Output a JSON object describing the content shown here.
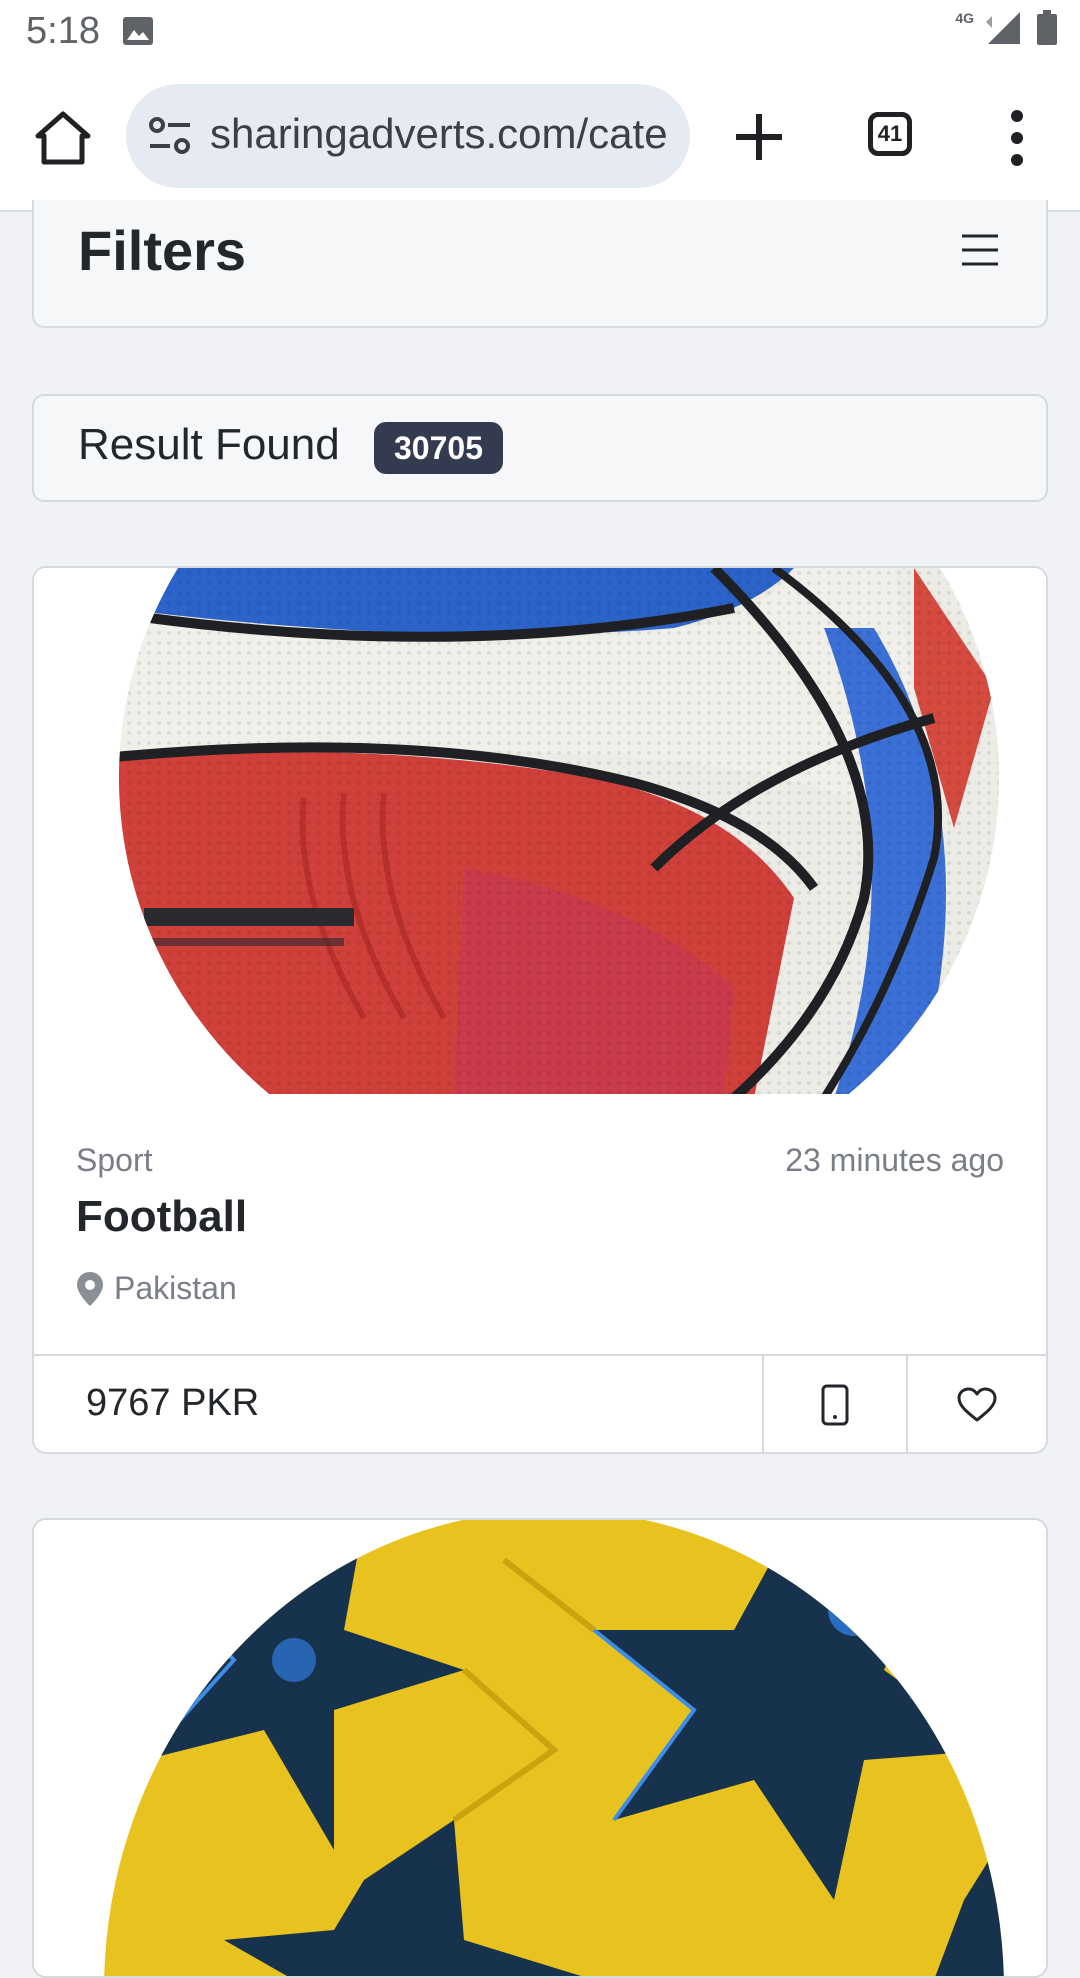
{
  "status_bar": {
    "time": "5:18",
    "network": "4G",
    "icons": [
      "image-icon",
      "signal-icon",
      "battery-icon"
    ]
  },
  "browser": {
    "url": "sharingadverts.com/cate",
    "tab_count": "41",
    "icons": [
      "home-icon",
      "site-settings-icon",
      "plus-icon",
      "more-vert-icon"
    ]
  },
  "filters": {
    "title": "Filters",
    "icon": "hamburger-icon"
  },
  "results": {
    "label": "Result Found",
    "count": "30705"
  },
  "ads": [
    {
      "category": "Sport",
      "time_ago": "23 minutes ago",
      "title": "Football",
      "location": "Pakistan",
      "price": "9767 PKR",
      "image": "red-white-blue-ball-photo"
    },
    {
      "image": "yellow-blue-star-ball-photo"
    }
  ],
  "colors": {
    "page_bg": "#f0f2f6",
    "badge_bg": "#343a4f",
    "url_bar_bg": "#e6ebf3"
  }
}
